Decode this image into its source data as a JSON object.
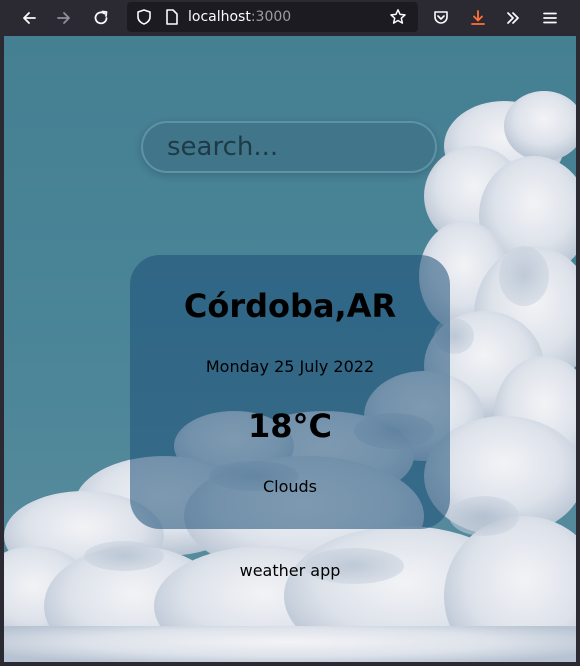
{
  "browser": {
    "url_host": "localhost",
    "url_port": ":3000"
  },
  "search": {
    "placeholder": "search..."
  },
  "weather": {
    "city": "Córdoba,AR",
    "date": "Monday 25 July 2022",
    "temperature": "18°C",
    "condition": "Clouds"
  },
  "footer": {
    "label": "weather app"
  },
  "colors": {
    "sky": "#457f92",
    "card": "#2a5a7e",
    "toolbar": "#2b2a33",
    "download_accent": "#ff7139"
  },
  "icons": {
    "back": "arrow-left-icon",
    "forward": "arrow-right-icon",
    "reload": "reload-icon",
    "shield": "shield-icon",
    "page": "page-icon",
    "bookmark": "star-icon",
    "pocket": "pocket-icon",
    "download": "download-icon",
    "overflow": "chevron-double-right-icon",
    "menu": "hamburger-menu-icon"
  }
}
